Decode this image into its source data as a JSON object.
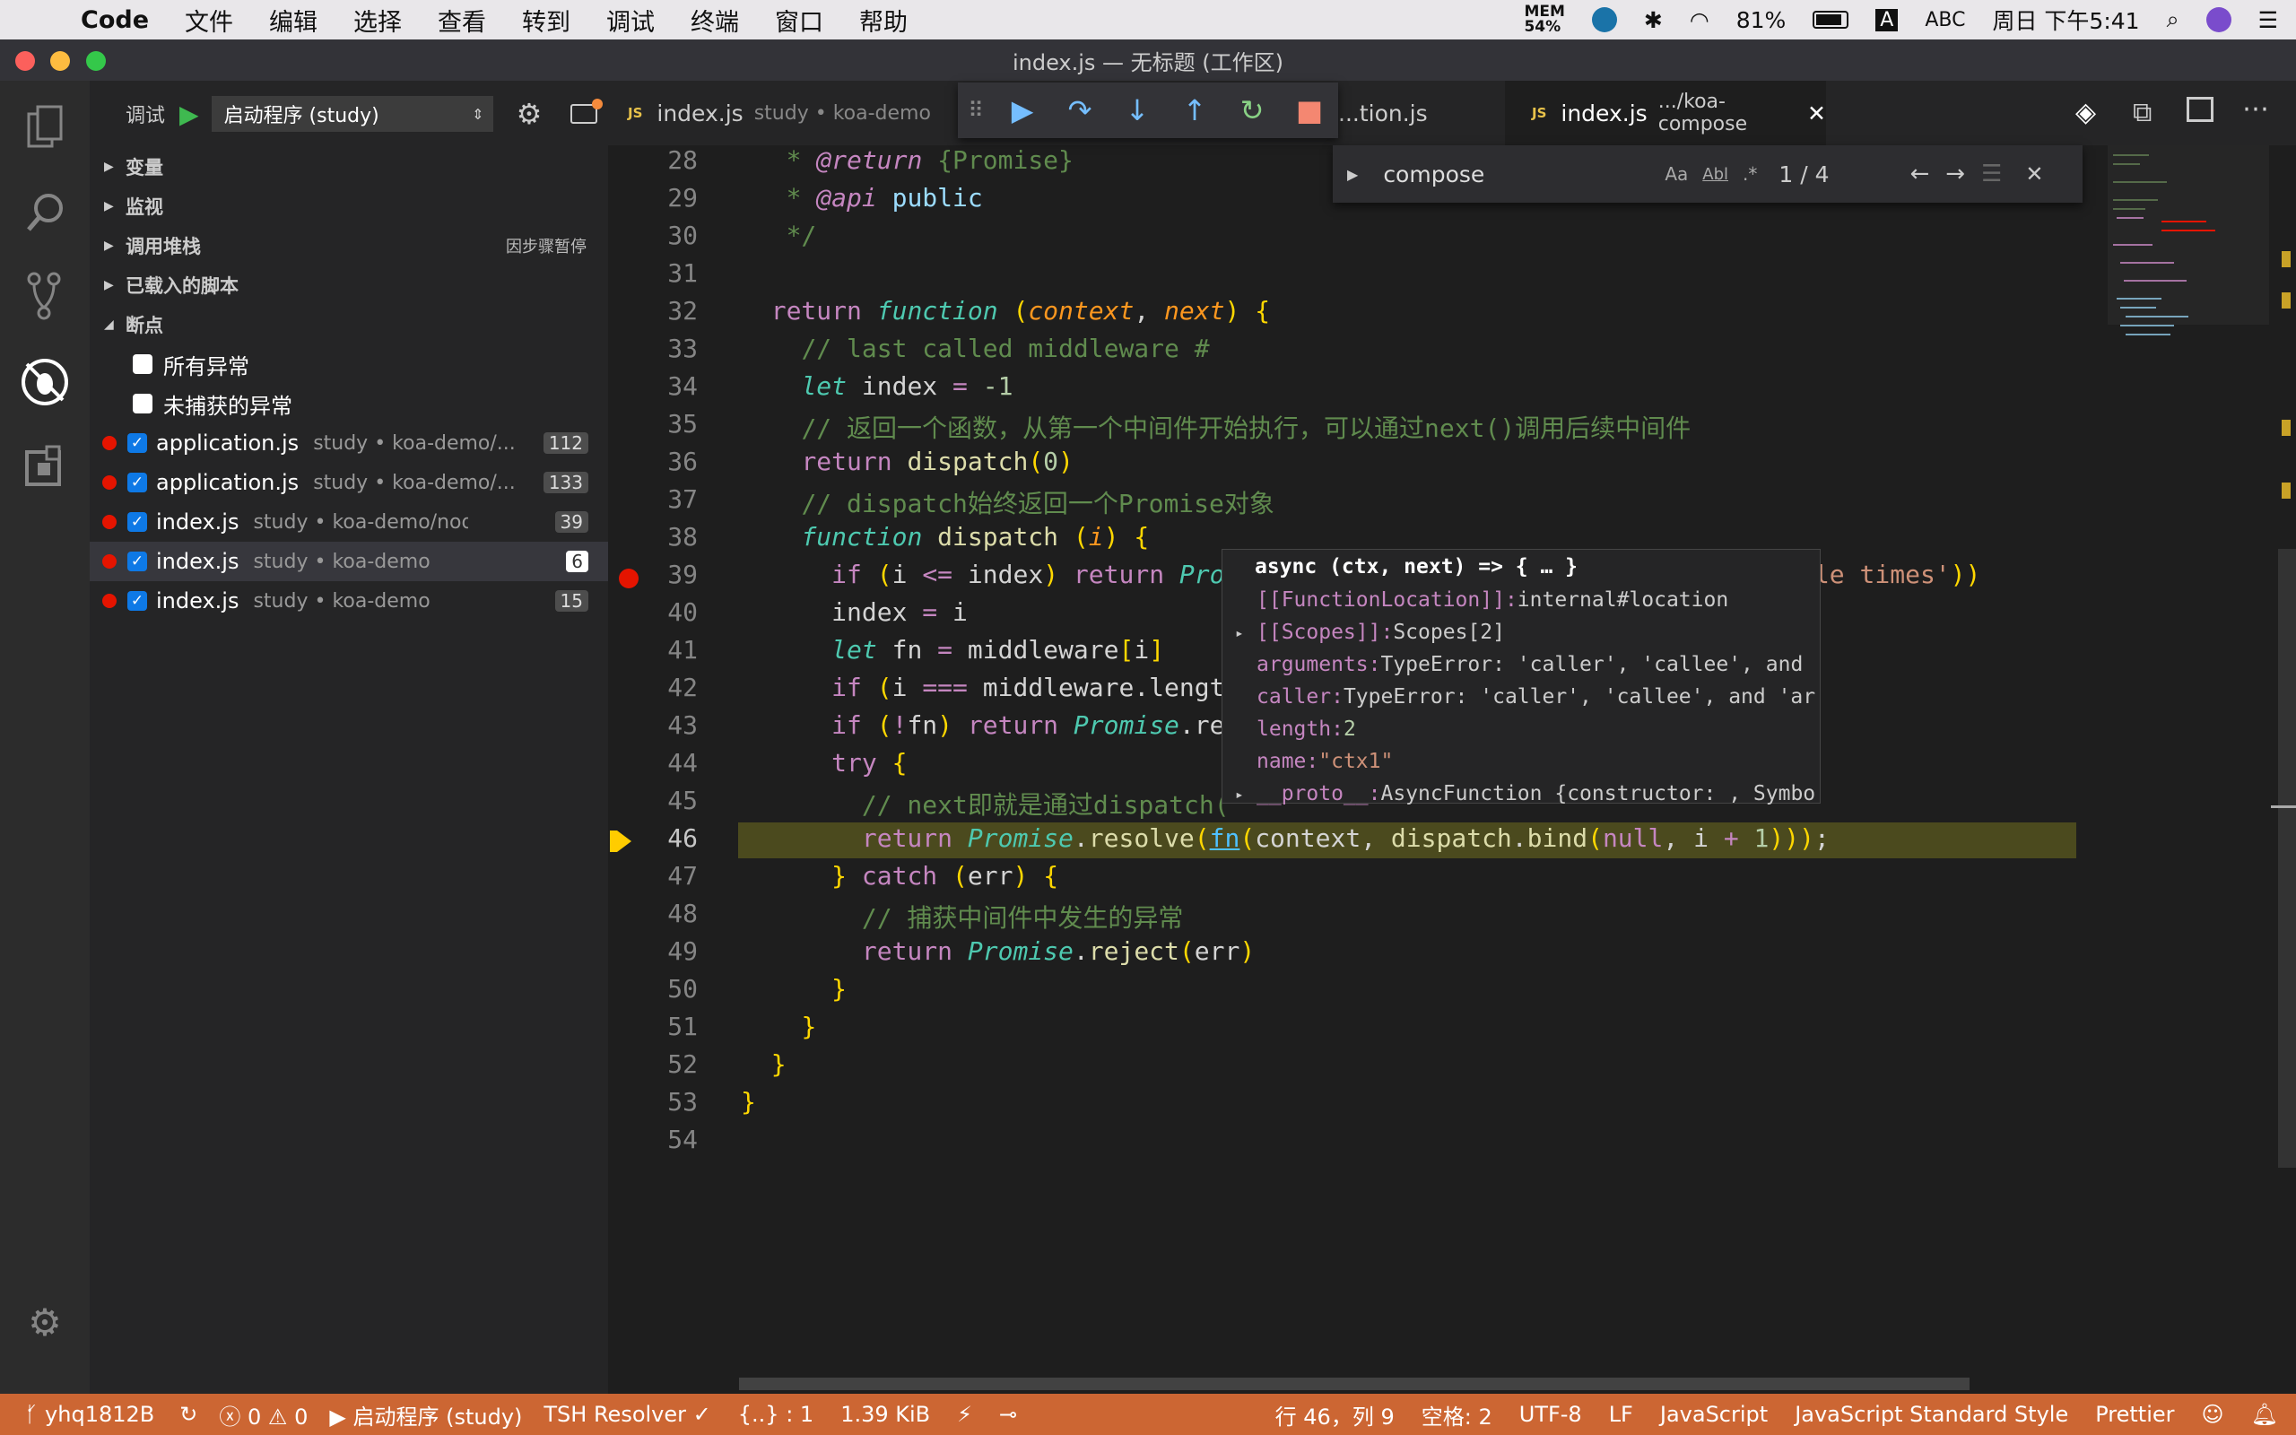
{
  "menubar": {
    "app": "Code",
    "items": [
      "文件",
      "编辑",
      "选择",
      "查看",
      "转到",
      "调试",
      "终端",
      "窗口",
      "帮助"
    ],
    "mem_label": "MEM",
    "mem_value": "54%",
    "battery": "81%",
    "input": "ABC",
    "clock": "周日 下午5:41"
  },
  "window": {
    "title": "index.js — 无标题 (工作区)"
  },
  "debug": {
    "label": "调试",
    "config": "启动程序 (study)"
  },
  "sections": {
    "variables": "变量",
    "watch": "监视",
    "callstack": "调用堆栈",
    "callstack_status": "因步骤暂停",
    "loaded": "已载入的脚本",
    "breakpoints": "断点"
  },
  "exceptions": [
    "所有异常",
    "未捕获的异常"
  ],
  "breakpoints": [
    {
      "file": "application.js",
      "path": "study • koa-demo/...",
      "line": "112"
    },
    {
      "file": "application.js",
      "path": "study • koa-demo/...",
      "line": "133"
    },
    {
      "file": "index.js",
      "path": "study • koa-demo/node_...",
      "line": "39"
    },
    {
      "file": "index.js",
      "path": "study • koa-demo",
      "line": "6"
    },
    {
      "file": "index.js",
      "path": "study • koa-demo",
      "line": "15"
    }
  ],
  "tabs": [
    {
      "name": "index.js",
      "path": "study • koa-demo"
    },
    {
      "name": "...tion.js",
      "path": ""
    },
    {
      "name": "index.js",
      "path": ".../koa-compose"
    }
  ],
  "find": {
    "query": "compose",
    "opt_case": "Aa",
    "opt_word": "Abl",
    "opt_regex": ".*",
    "count": "1 / 4"
  },
  "editor": {
    "line_numbers": [
      "28",
      "29",
      "30",
      "31",
      "32",
      "33",
      "34",
      "35",
      "36",
      "37",
      "38",
      "39",
      "40",
      "41",
      "42",
      "43",
      "44",
      "45",
      "46",
      "47",
      "48",
      "49",
      "50",
      "51",
      "52",
      "53",
      "54"
    ]
  },
  "hover": {
    "title": "async (ctx, next) => { … }",
    "rows": [
      {
        "key": "[[FunctionLocation]]:",
        "val": " internal#location",
        "exp": ""
      },
      {
        "key": "[[Scopes]]:",
        "val": " Scopes[2]",
        "exp": "▸"
      },
      {
        "key": "arguments:",
        "val": " TypeError: 'caller', 'callee', and",
        "exp": ""
      },
      {
        "key": "caller:",
        "val": " TypeError: 'caller', 'callee', and 'ar",
        "exp": ""
      },
      {
        "key": "length:",
        "val": " 2",
        "exp": ""
      },
      {
        "key": "name:",
        "val": " \"ctx1\"",
        "exp": ""
      },
      {
        "key": "__proto__:",
        "val": " AsyncFunction {constructor: , Symbo",
        "exp": "▸"
      }
    ]
  },
  "status": {
    "branch": "yhq1812B",
    "errors": "0",
    "warnings": "0",
    "run": "启动程序 (study)",
    "resolver": "TSH Resolver ✓",
    "braces": "{..} : 1",
    "size": "1.39 KiB",
    "position": "行 46，列 9",
    "spaces": "空格: 2",
    "encoding": "UTF-8",
    "eol": "LF",
    "language": "JavaScript",
    "style": "JavaScript Standard Style",
    "formatter": "Prettier"
  },
  "colors": {
    "accent": "#cc6633",
    "breakpoint": "#e51400",
    "checkbox": "#0e79e6",
    "current_line": "#4b4a1e"
  }
}
